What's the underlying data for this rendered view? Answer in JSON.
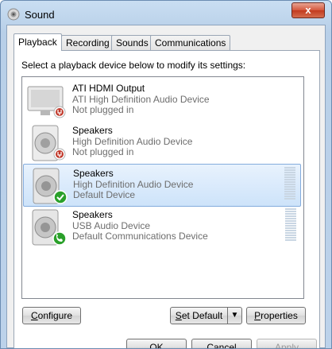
{
  "window": {
    "title": "Sound",
    "close_glyph": "x"
  },
  "tabs": [
    {
      "label": "Playback",
      "active": true
    },
    {
      "label": "Recording",
      "active": false
    },
    {
      "label": "Sounds",
      "active": false
    },
    {
      "label": "Communications",
      "active": false
    }
  ],
  "instruction": "Select a playback device below to modify its settings:",
  "devices": [
    {
      "name": "ATI HDMI Output",
      "description": "ATI High Definition Audio Device",
      "status": "Not plugged in",
      "icon": "monitor-icon",
      "badge": "unplugged-badge-icon",
      "selected": false
    },
    {
      "name": "Speakers",
      "description": "High Definition Audio Device",
      "status": "Not plugged in",
      "icon": "speaker-icon",
      "badge": "unplugged-badge-icon",
      "selected": false
    },
    {
      "name": "Speakers",
      "description": "High Definition Audio Device",
      "status": "Default Device",
      "icon": "speaker-icon",
      "badge": "default-check-icon",
      "selected": true
    },
    {
      "name": "Speakers",
      "description": "USB Audio Device",
      "status": "Default Communications Device",
      "icon": "speaker-icon",
      "badge": "phone-badge-icon",
      "selected": false
    }
  ],
  "buttons": {
    "configure": {
      "underline": "C",
      "rest": "onfigure"
    },
    "set_default": {
      "underline": "S",
      "rest": "et Default"
    },
    "properties": {
      "underline": "P",
      "rest": "roperties"
    },
    "ok": "OK",
    "cancel": "Cancel",
    "apply": "Apply"
  },
  "colors": {
    "accent": "#84acdd",
    "default_check": "#2aa02a",
    "unplugged": "#c0392b",
    "phone": "#2aa02a"
  }
}
